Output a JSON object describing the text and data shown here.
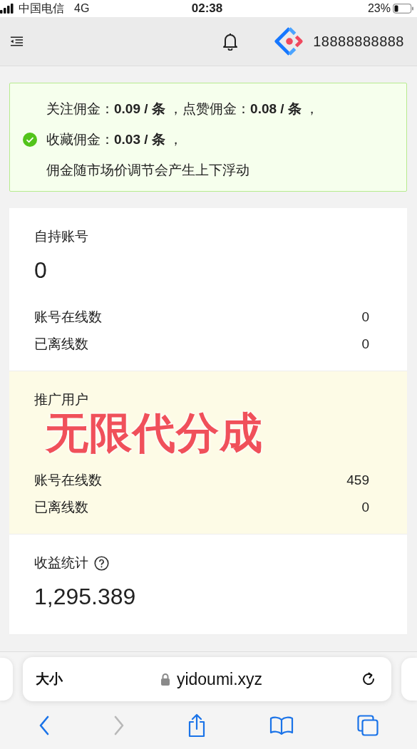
{
  "status_bar": {
    "carrier": "中国电信",
    "network": "4G",
    "time": "02:38",
    "battery": "23%"
  },
  "header": {
    "user": "18888888888"
  },
  "notice": {
    "lines": [
      "关注佣金：**0.09 / 条** ，点赞佣金：**0.08 / 条** ，",
      "收藏佣金：**0.03 / 条** ，",
      "佣金随市场价调节会产生上下浮动"
    ]
  },
  "cards": [
    {
      "title": "自持账号",
      "value": "0",
      "highlight": false,
      "rows": [
        {
          "label": "账号在线数",
          "value": "0"
        },
        {
          "label": "已离线数",
          "value": "0"
        }
      ]
    },
    {
      "title": "推广用户",
      "highlight": true,
      "caption": "无限代分成",
      "rows": [
        {
          "label": "账号在线数",
          "value": "459"
        },
        {
          "label": "已离线数",
          "value": "0"
        }
      ]
    },
    {
      "title": "收益统计",
      "help": true,
      "value": "1,295.389",
      "highlight": false
    }
  ],
  "browser": {
    "text_size": "大小",
    "url": "yidoumi.xyz",
    "toolbar": [
      {
        "kind": "back",
        "disabled": false
      },
      {
        "kind": "forward",
        "disabled": true
      },
      {
        "kind": "share",
        "disabled": false
      },
      {
        "kind": "bookmarks",
        "disabled": false
      },
      {
        "kind": "tabs",
        "disabled": false
      }
    ]
  }
}
